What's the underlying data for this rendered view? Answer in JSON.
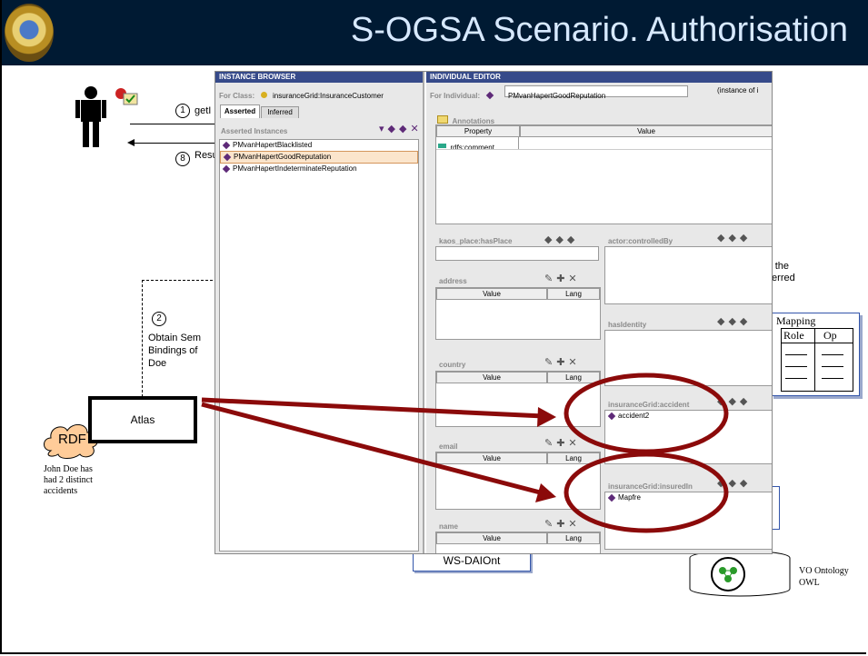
{
  "slide": {
    "title": "S-OGSA Scenario. Authorisation",
    "step1_num": "1",
    "step1_label": "getI",
    "step8_num": "8",
    "step8_label": "Resu",
    "step2_num": "2",
    "step2_text_lines": [
      "Obtain Sem",
      "Bindings of",
      "Doe"
    ],
    "atlas_label": "Atlas",
    "rdf_label": "RDF",
    "rdf_caption_lines": [
      "John Doe has",
      "had 2 distinct",
      "accidents"
    ],
    "right_fragment_lines": [
      "r the",
      "ferred"
    ],
    "mapping": {
      "title": "Mapping",
      "col_role": "Role",
      "col_op": "Op"
    },
    "ws_daiont": "WS-DAIOnt",
    "vo_ontology_lines": [
      "VO Ontology",
      "OWL"
    ]
  },
  "protege": {
    "instance_browser": {
      "title": "INSTANCE BROWSER",
      "for_class_label": "For Class:",
      "class_name": "insuranceGrid:InsuranceCustomer",
      "tabs": [
        "Asserted",
        "Inferred"
      ],
      "asserted_label": "Asserted Instances",
      "instances": [
        "PMvanHapertBlacklisted",
        "PMvanHapertGoodReputation",
        "PMvanHapertIndeterminateReputation"
      ],
      "selected_index": 1
    },
    "individual_editor": {
      "title": "INDIVIDUAL EDITOR",
      "for_individual_label": "For Individual:",
      "individual_name": "PMvanHapertGoodReputation",
      "instance_of": "(instance of i",
      "annotations_label": "Annotations",
      "annotations_header": [
        "Property",
        "Value"
      ],
      "annotation_row": "rdfs:comment",
      "slots": {
        "kaos_place": "kaos_place:hasPlace",
        "actor": "actor:controlledBy",
        "address": "address",
        "hasidentity": "hasIdentity",
        "country": "country",
        "accident": "insuranceGrid:accident",
        "accident_value": "accident2",
        "email": "email",
        "insuredin": "insuranceGrid:insuredIn",
        "insuredin_value": "Mapfre",
        "name": "name"
      },
      "col_value": "Value",
      "col_lang": "Lang"
    }
  },
  "colors": {
    "title_bg": "#001a33",
    "title_text": "#d7e9ff",
    "arrow": "#8b0a0a",
    "panel_title": "#364a8a",
    "rdf_cloud": "#ffcc99"
  }
}
